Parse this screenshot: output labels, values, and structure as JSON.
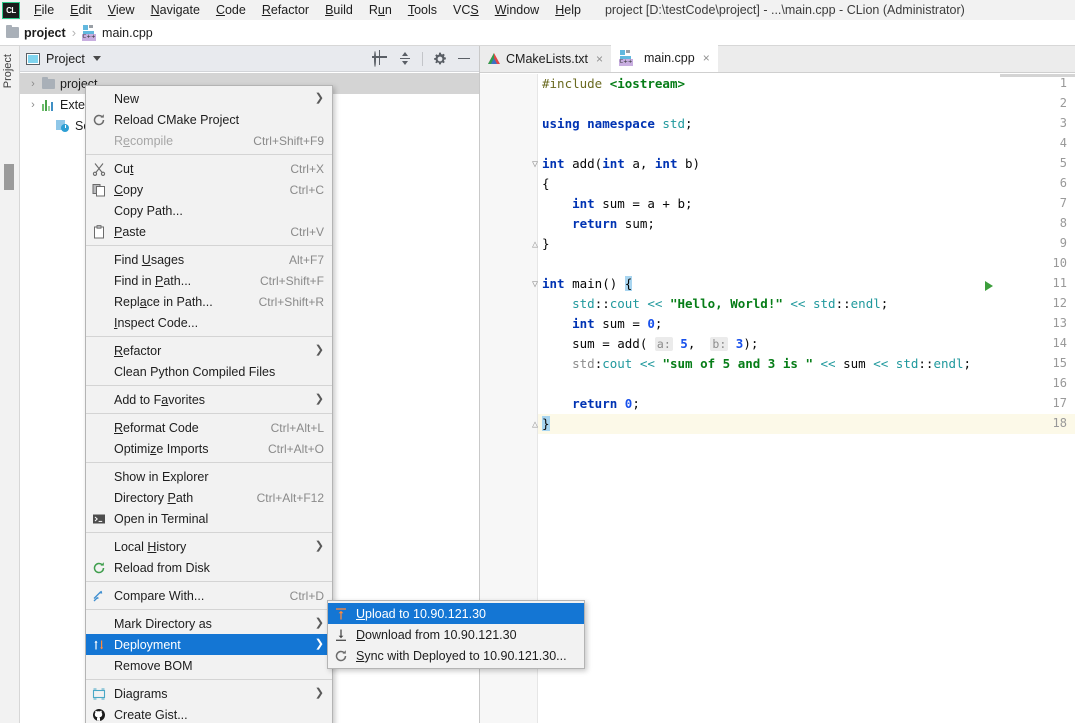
{
  "window": {
    "logo": "CL",
    "title": "project [D:\\testCode\\project] - ...\\main.cpp - CLion (Administrator)"
  },
  "menubar": {
    "items": [
      {
        "label": "File"
      },
      {
        "label": "Edit"
      },
      {
        "label": "View"
      },
      {
        "label": "Navigate"
      },
      {
        "label": "Code"
      },
      {
        "label": "Refactor"
      },
      {
        "label": "Build"
      },
      {
        "label": "Run"
      },
      {
        "label": "Tools"
      },
      {
        "label": "VCS"
      },
      {
        "label": "Window"
      },
      {
        "label": "Help"
      }
    ]
  },
  "breadcrumb": {
    "project": "project",
    "separator": "›",
    "file": "main.cpp"
  },
  "sidebar": {
    "vertical_label": "Project",
    "panel_title": "Project",
    "tools": [
      "locate-icon",
      "collapse-all-icon",
      "settings-icon",
      "hide-icon"
    ],
    "tree": [
      {
        "label": "project",
        "icon": "folder-icon",
        "twisty": "›"
      },
      {
        "label": "External Libraries",
        "icon": "library-icon",
        "twisty": "›"
      },
      {
        "label": "Scratches and Consoles",
        "icon": "scratch-icon",
        "twisty": ""
      }
    ]
  },
  "context_menu": {
    "groups": [
      [
        {
          "label": "New",
          "mnemonic": "",
          "shortcut": "",
          "submenu": true,
          "icon": "",
          "disabled": false
        },
        {
          "label": "Reload CMake Project",
          "shortcut": "",
          "submenu": false,
          "icon": "reload-icon",
          "disabled": false
        },
        {
          "label": "Recompile",
          "shortcut": "Ctrl+Shift+F9",
          "submenu": false,
          "icon": "",
          "disabled": true
        }
      ],
      [
        {
          "label": "Cut",
          "shortcut": "Ctrl+X",
          "submenu": false,
          "icon": "scissors-icon",
          "disabled": false
        },
        {
          "label": "Copy",
          "shortcut": "Ctrl+C",
          "submenu": false,
          "icon": "copy-icon",
          "disabled": false
        },
        {
          "label": "Copy Path...",
          "shortcut": "",
          "submenu": false,
          "icon": "",
          "disabled": false
        },
        {
          "label": "Paste",
          "shortcut": "Ctrl+V",
          "submenu": false,
          "icon": "paste-icon",
          "disabled": false
        }
      ],
      [
        {
          "label": "Find Usages",
          "shortcut": "Alt+F7",
          "submenu": false,
          "icon": "",
          "disabled": false
        },
        {
          "label": "Find in Path...",
          "shortcut": "Ctrl+Shift+F",
          "submenu": false,
          "icon": "",
          "disabled": false
        },
        {
          "label": "Replace in Path...",
          "shortcut": "Ctrl+Shift+R",
          "submenu": false,
          "icon": "",
          "disabled": false
        },
        {
          "label": "Inspect Code...",
          "shortcut": "",
          "submenu": false,
          "icon": "",
          "disabled": false
        }
      ],
      [
        {
          "label": "Refactor",
          "shortcut": "",
          "submenu": true,
          "icon": "",
          "disabled": false
        },
        {
          "label": "Clean Python Compiled Files",
          "shortcut": "",
          "submenu": false,
          "icon": "",
          "disabled": false
        }
      ],
      [
        {
          "label": "Add to Favorites",
          "shortcut": "",
          "submenu": true,
          "icon": "",
          "disabled": false
        }
      ],
      [
        {
          "label": "Reformat Code",
          "shortcut": "Ctrl+Alt+L",
          "submenu": false,
          "icon": "",
          "disabled": false
        },
        {
          "label": "Optimize Imports",
          "shortcut": "Ctrl+Alt+O",
          "submenu": false,
          "icon": "",
          "disabled": false
        }
      ],
      [
        {
          "label": "Show in Explorer",
          "shortcut": "",
          "submenu": false,
          "icon": "",
          "disabled": false
        },
        {
          "label": "Directory Path",
          "shortcut": "Ctrl+Alt+F12",
          "submenu": false,
          "icon": "",
          "disabled": false
        },
        {
          "label": "Open in Terminal",
          "shortcut": "",
          "submenu": false,
          "icon": "terminal-icon",
          "disabled": false
        }
      ],
      [
        {
          "label": "Local History",
          "shortcut": "",
          "submenu": true,
          "icon": "",
          "disabled": false
        },
        {
          "label": "Reload from Disk",
          "shortcut": "",
          "submenu": false,
          "icon": "reload-icon",
          "disabled": false
        }
      ],
      [
        {
          "label": "Compare With...",
          "shortcut": "Ctrl+D",
          "submenu": false,
          "icon": "compare-icon",
          "disabled": false
        }
      ],
      [
        {
          "label": "Mark Directory as",
          "shortcut": "",
          "submenu": true,
          "icon": "",
          "disabled": false
        },
        {
          "label": "Deployment",
          "shortcut": "",
          "submenu": true,
          "icon": "deployment-icon",
          "disabled": false,
          "selected": true
        },
        {
          "label": "Remove BOM",
          "shortcut": "",
          "submenu": false,
          "icon": "",
          "disabled": false
        }
      ],
      [
        {
          "label": "Diagrams",
          "shortcut": "",
          "submenu": true,
          "icon": "diagram-icon",
          "disabled": false
        },
        {
          "label": "Create Gist...",
          "shortcut": "",
          "submenu": false,
          "icon": "github-icon",
          "disabled": false
        }
      ]
    ],
    "highlight_color": "#1476d4"
  },
  "submenu": {
    "items": [
      {
        "label": "Upload to 10.90.121.30",
        "icon": "upload-icon",
        "selected": true
      },
      {
        "label": "Download from 10.90.121.30",
        "icon": "download-icon",
        "selected": false
      },
      {
        "label": "Sync with Deployed to 10.90.121.30...",
        "icon": "sync-icon",
        "selected": false
      }
    ]
  },
  "editor": {
    "tabs": [
      {
        "label": "CMakeLists.txt",
        "icon": "cmake-icon",
        "active": false,
        "close": "×"
      },
      {
        "label": "main.cpp",
        "icon": "cpp-icon",
        "active": true,
        "close": "×"
      }
    ],
    "line_numbers": [
      1,
      2,
      3,
      4,
      5,
      6,
      7,
      8,
      9,
      10,
      11,
      12,
      13,
      14,
      15,
      16,
      17,
      18
    ],
    "highlighted_line": 18,
    "run_marker_line": 11,
    "code": [
      "#include <iostream>",
      "",
      "using namespace std;",
      "",
      "int add(int a, int b)",
      "{",
      "    int sum = a + b;",
      "    return sum;",
      "}",
      "",
      "int main() {",
      "    std::cout << \"Hello, World!\" << std::endl;",
      "    int sum = 0;",
      "    sum = add( a: 5,  b: 3);",
      "    std:cout << \"sum of 5 and 3 is \" << sum << std::endl;",
      "",
      "    return 0;",
      "}"
    ]
  }
}
